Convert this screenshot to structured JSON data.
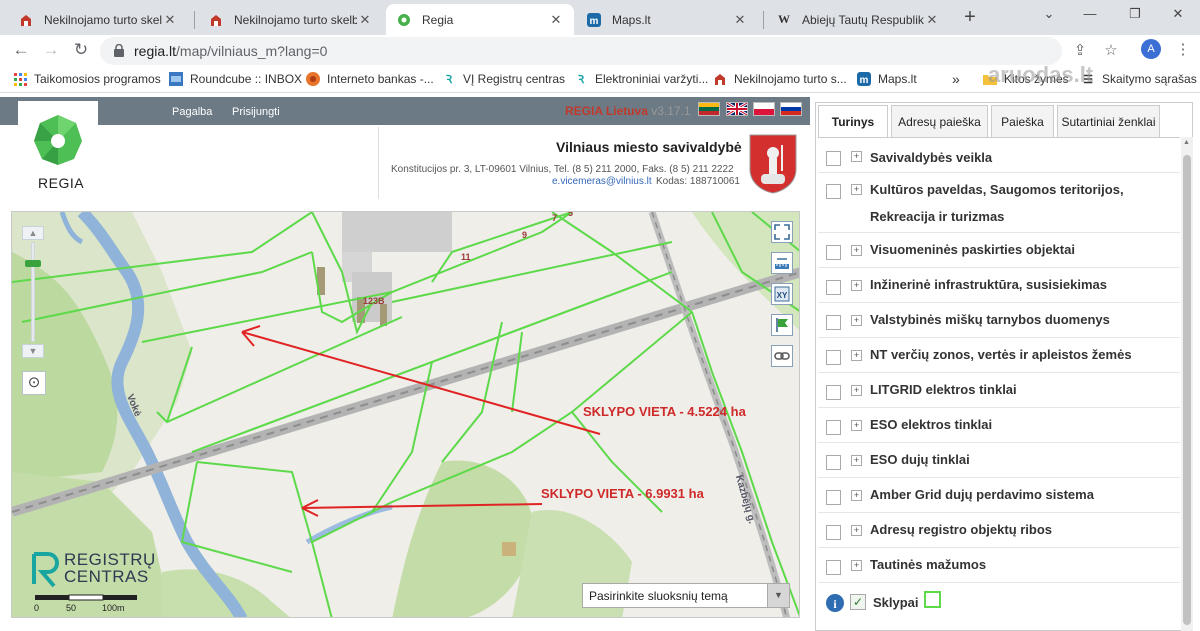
{
  "browser": {
    "tabs": [
      {
        "title": "Nekilnojamo turto skelbim",
        "icon": "house-logo-icon",
        "active": false
      },
      {
        "title": "Nekilnojamo turto skelbim",
        "icon": "house-logo-icon",
        "active": false
      },
      {
        "title": "Regia",
        "icon": "regia-logo-icon",
        "active": true
      },
      {
        "title": "Maps.lt",
        "icon": "maps-logo-icon",
        "active": false
      },
      {
        "title": "Abiejų Tautų Respublika –",
        "icon": "wikipedia-icon",
        "active": false
      }
    ],
    "url_host": "regia.lt",
    "url_path": "/map/vilniaus_m?lang=0",
    "profile_initial": "A",
    "bookmarks": [
      {
        "label": "Taikomosios programos",
        "icon": "apps-grid-icon"
      },
      {
        "label": "Roundcube :: INBOX",
        "icon": "roundcube-icon"
      },
      {
        "label": "Interneto bankas -...",
        "icon": "bank-icon"
      },
      {
        "label": "VĮ Registrų centras",
        "icon": "registru-centras-icon"
      },
      {
        "label": "Elektroniniai varžyti...",
        "icon": "registru-centras-icon"
      },
      {
        "label": "Nekilnojamo turto s...",
        "icon": "house-logo-icon"
      },
      {
        "label": "Maps.lt",
        "icon": "maps-logo-icon"
      },
      {
        "label": "»",
        "icon": ""
      },
      {
        "label": "Kitos žymės",
        "icon": "folder-icon"
      },
      {
        "label": "Skaitymo sąrašas",
        "icon": "reading-list-icon"
      }
    ],
    "watermark": "aruodas.lt"
  },
  "regia": {
    "links": [
      "Pagalba",
      "Prisijungti"
    ],
    "title_prefix": "REGIA Lietuva",
    "version": "v3.17.1",
    "logo_label": "REGIA",
    "municipality": {
      "name": "Vilniaus miesto savivaldybė",
      "address": "Konstitucijos pr. 3, LT-09601 Vilnius, Tel. (8 5) 211 2000, Faks. (8 5) 211 2222",
      "email": "e.vicemeras@vilnius.lt",
      "code": "Kodas: 188710061"
    },
    "languages": [
      "lt",
      "en",
      "pl",
      "ru"
    ]
  },
  "map": {
    "annotations": [
      {
        "text": "SKLYPO VIETA - 4.5224 ha"
      },
      {
        "text": "SKLYPO VIETA - 6.9931 ha"
      }
    ],
    "plot_numbers": [
      "123B",
      "11",
      "9",
      "7",
      "5"
    ],
    "river_label": "Vokė",
    "street_label": "Kazbėjų g.",
    "brand_line1": "REGISTRŲ",
    "brand_line2": "CENTRAS",
    "scale_labels": [
      "0",
      "50",
      "100m"
    ],
    "theme_select": "Pasirinkite sluoksnių temą"
  },
  "layers_panel": {
    "tabs": [
      "Turinys",
      "Adresų paieška",
      "Paieška",
      "Sutartiniai ženklai"
    ],
    "active_tab": "Turinys",
    "layers": [
      {
        "label": "Savivaldybės veikla",
        "checked": false
      },
      {
        "label": "Kultūros paveldas, Saugomos teritorijos, Rekreacija ir turizmas",
        "checked": false
      },
      {
        "label": "Visuomeninės paskirties objektai",
        "checked": false
      },
      {
        "label": "Inžinerinė infrastruktūra, susisiekimas",
        "checked": false
      },
      {
        "label": "Valstybinės miškų tarnybos duomenys",
        "checked": false
      },
      {
        "label": "NT verčių zonos, vertės ir apleistos žemės",
        "checked": false
      },
      {
        "label": "LITGRID elektros tinklai",
        "checked": false
      },
      {
        "label": "ESO elektros tinklai",
        "checked": false
      },
      {
        "label": "ESO dujų tinklai",
        "checked": false
      },
      {
        "label": "Amber Grid dujų perdavimo sistema",
        "checked": false
      },
      {
        "label": "Adresų registro objektų ribos",
        "checked": false
      },
      {
        "label": "Tautinės mažumos",
        "checked": false
      },
      {
        "label": "Sklypai",
        "checked": true
      }
    ],
    "colors": {
      "plot_outline": "#5dd94a",
      "accent_red": "#c0392b"
    }
  }
}
